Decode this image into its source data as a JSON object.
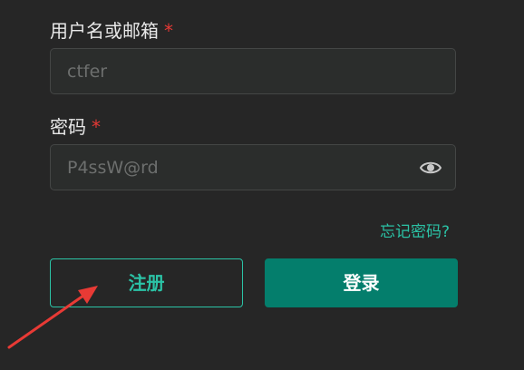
{
  "username": {
    "label": "用户名或邮箱",
    "required_mark": "*",
    "value": "",
    "placeholder": "ctfer"
  },
  "password": {
    "label": "密码",
    "required_mark": "*",
    "value": "",
    "placeholder": "P4ssW@rd",
    "toggle_icon": "eye-icon"
  },
  "forgot_password_label": "忘记密码?",
  "buttons": {
    "register_label": "注册",
    "login_label": "登录"
  },
  "annotation": {
    "type": "arrow",
    "points_to": "register-button",
    "color": "#e83a35"
  },
  "colors": {
    "background": "#262626",
    "accent": "#2bc3a6",
    "primary_button": "#047e6c",
    "required": "#e53935"
  }
}
